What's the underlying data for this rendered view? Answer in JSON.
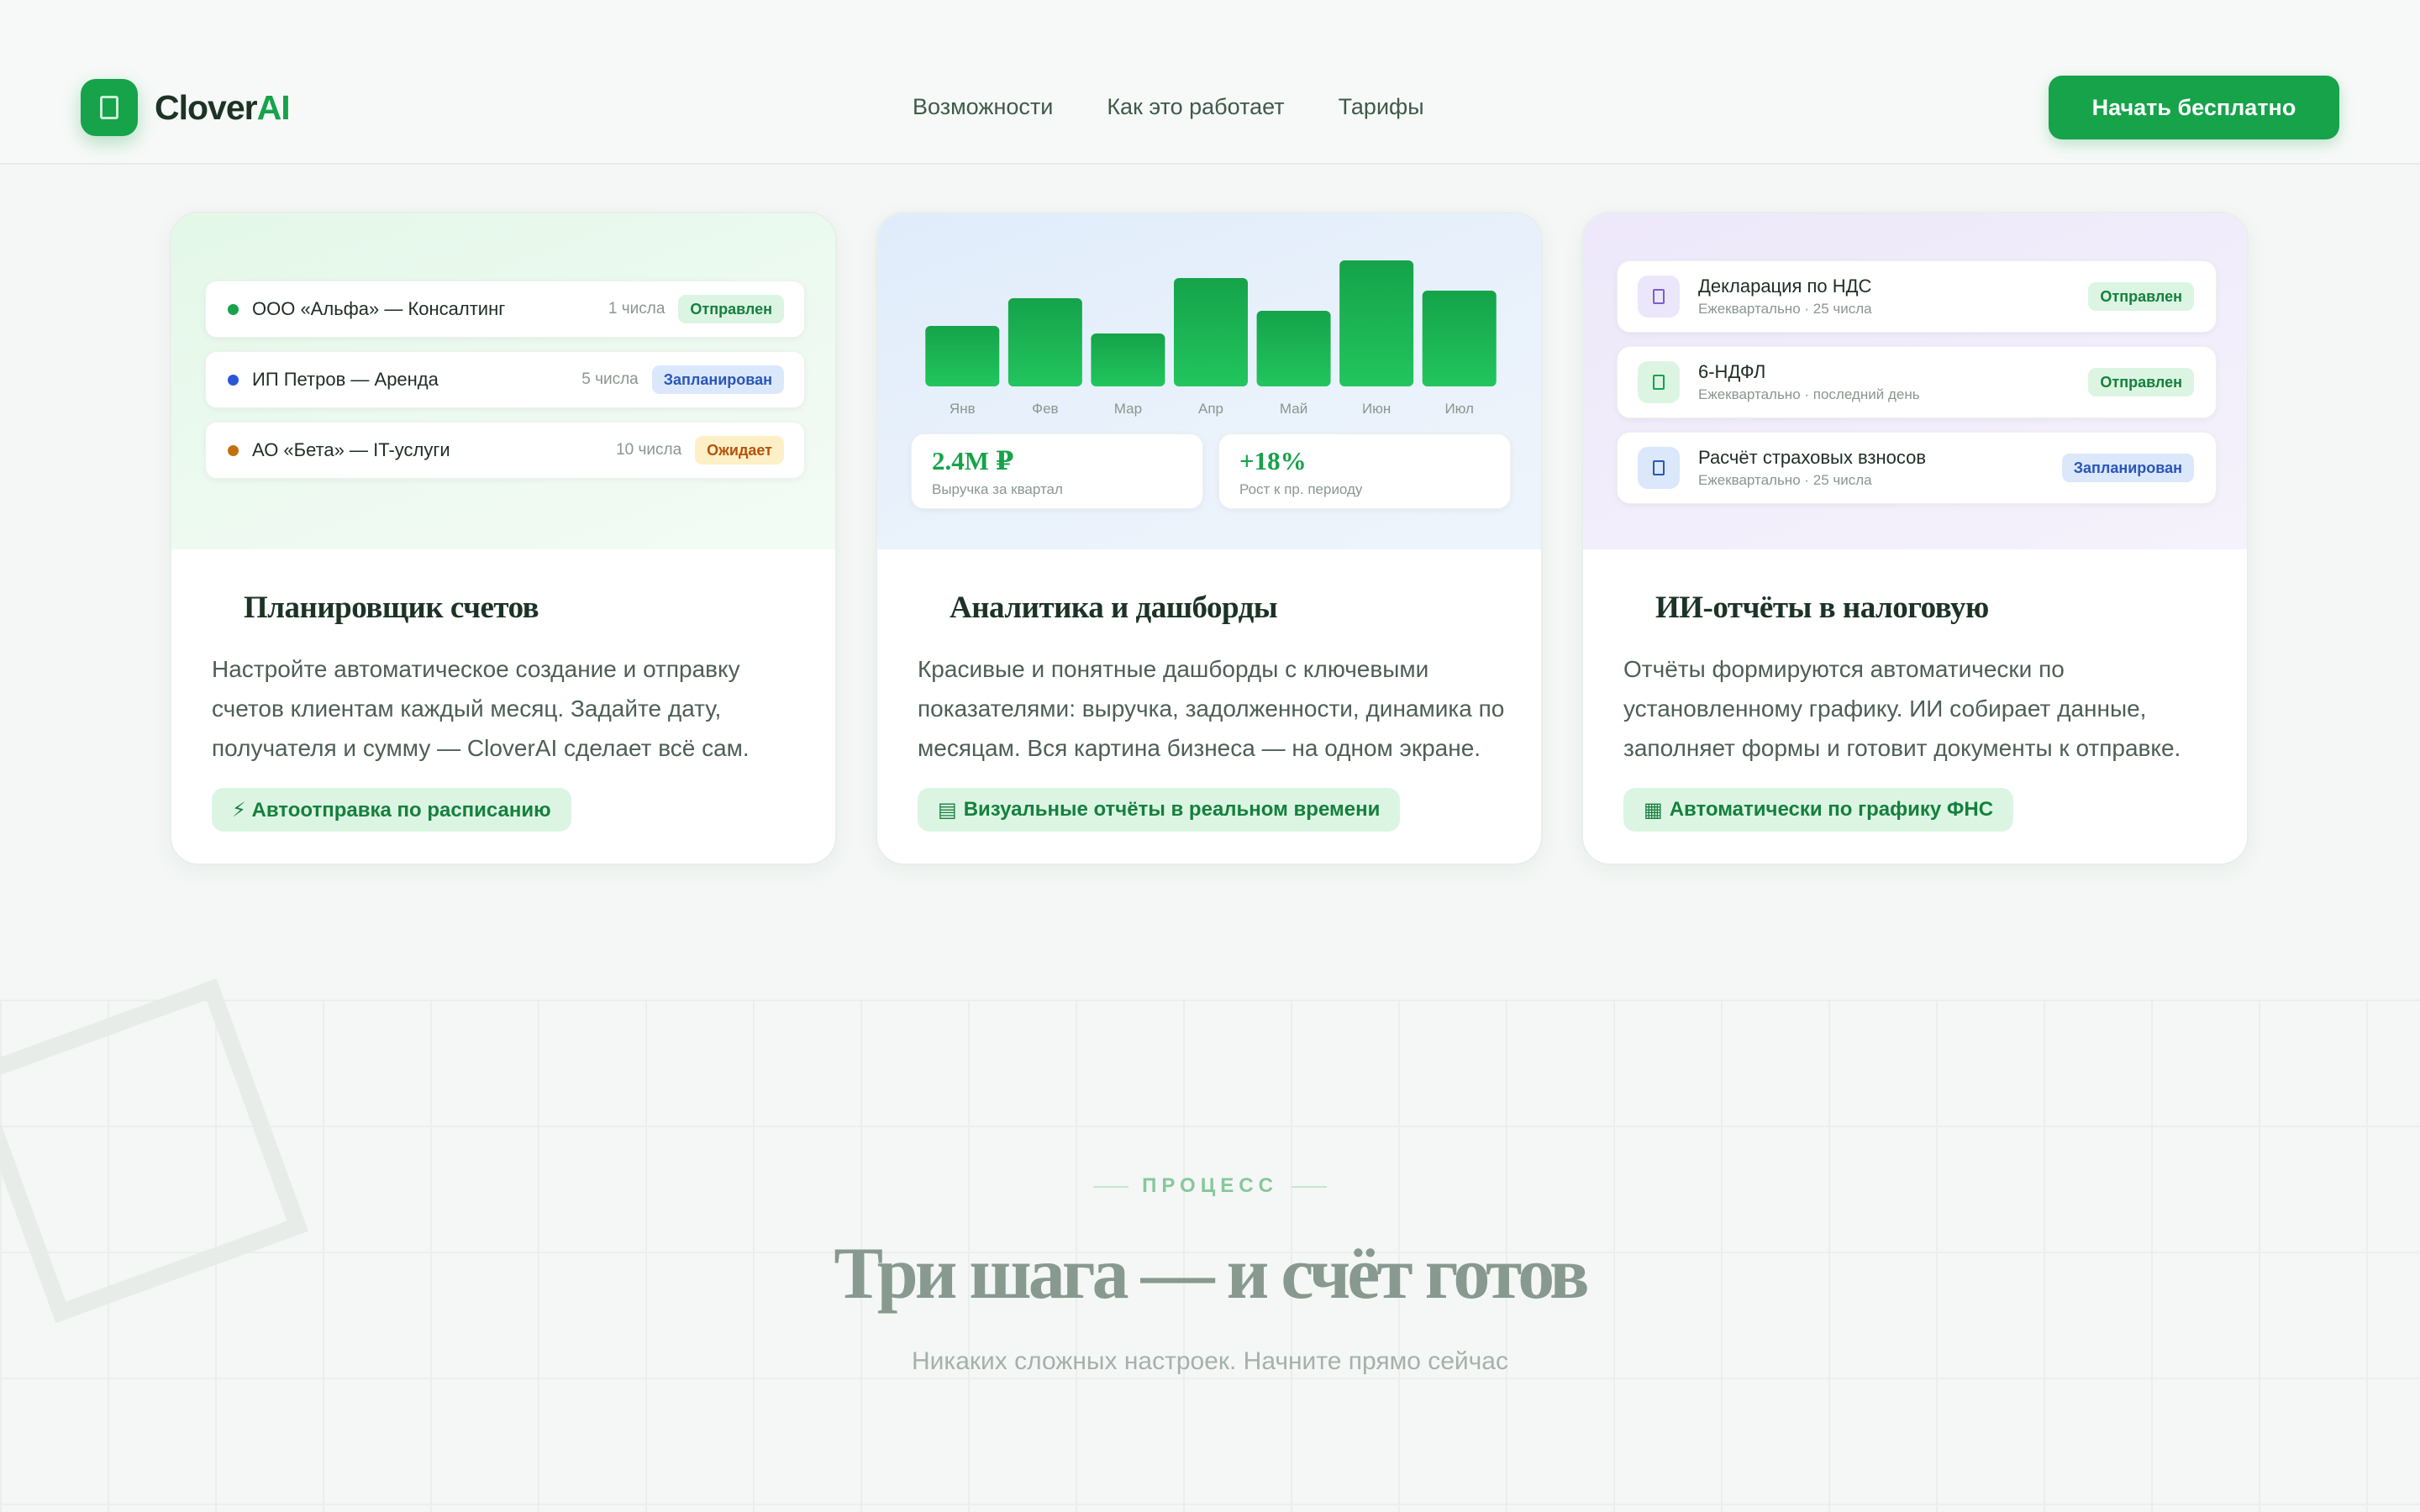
{
  "brand": {
    "name_main": "Clover",
    "name_accent": "AI",
    "accent": "#16a34a"
  },
  "nav": [
    {
      "label": "Возможности"
    },
    {
      "label": "Как это работает"
    },
    {
      "label": "Тарифы"
    }
  ],
  "header": {
    "cta_label": "Начать бесплатно"
  },
  "cards": [
    {
      "title": "Планировщик счетов",
      "description": "Настройте автоматическое создание и отправку счетов клиентам каждый месяц. Задайте дату, получателя и сумму — CloverAI сделает всё сам.",
      "chip": "⚡ Автоотправка по расписанию",
      "invoices": [
        {
          "name": "ООО «Альфа» — Консалтинг",
          "day": "1 числа",
          "status": "Отправлен",
          "dot_color": "#16a34a"
        },
        {
          "name": "ИП Петров — Аренда",
          "day": "5 числа",
          "status": "Запланирован",
          "dot_color": "#2a56d8"
        },
        {
          "name": "АО «Бета» — IT-услуги",
          "day": "10 числа",
          "status": "Ожидает",
          "dot_color": "#c2700e"
        }
      ]
    },
    {
      "title": "Аналитика и дашборды",
      "description": "Красивые и понятные дашборды с ключевыми показателями: выручка, задолженности, динамика по месяцам. Вся картина бизнеса — на одном экране.",
      "chip": "Визуальные отчёты в реальном времени",
      "chart_data": {
        "type": "bar",
        "categories": [
          "Янв",
          "Фев",
          "Мар",
          "Апр",
          "Май",
          "Июн",
          "Июл"
        ],
        "values": [
          48,
          70,
          42,
          86,
          60,
          100,
          76
        ],
        "title": "",
        "xlabel": "",
        "ylabel": "",
        "ylim": [
          0,
          100
        ],
        "grid": false,
        "bar_color": "#1aae53"
      },
      "stats": [
        {
          "value": "2.4M ₽",
          "label": "Выручка за квартал"
        },
        {
          "value": "+18%",
          "label": "Рост к пр. периоду"
        }
      ]
    },
    {
      "title": "ИИ-отчёты в налоговую",
      "description": "Отчёты формируются автоматически по установленному графику. ИИ собирает данные, заполняет формы и готовит документы к отправке.",
      "chip": "Автоматически по графику ФНС",
      "reports": [
        {
          "name": "Декларация по НДС",
          "sub": "Ежеквартально · 25 числа",
          "status": "Отправлен"
        },
        {
          "name": "6-НДФЛ",
          "sub": "Ежеквартально · последний день",
          "status": "Отправлен"
        },
        {
          "name": "Расчёт страховых взносов",
          "sub": "Ежеквартально · 25 числа",
          "status": "Запланирован"
        }
      ]
    }
  ],
  "process": {
    "eyebrow": "ПРОЦЕСС",
    "title": "Три шага — и счёт готов",
    "subtitle": "Никаких сложных настроек. Начните прямо сейчас"
  }
}
